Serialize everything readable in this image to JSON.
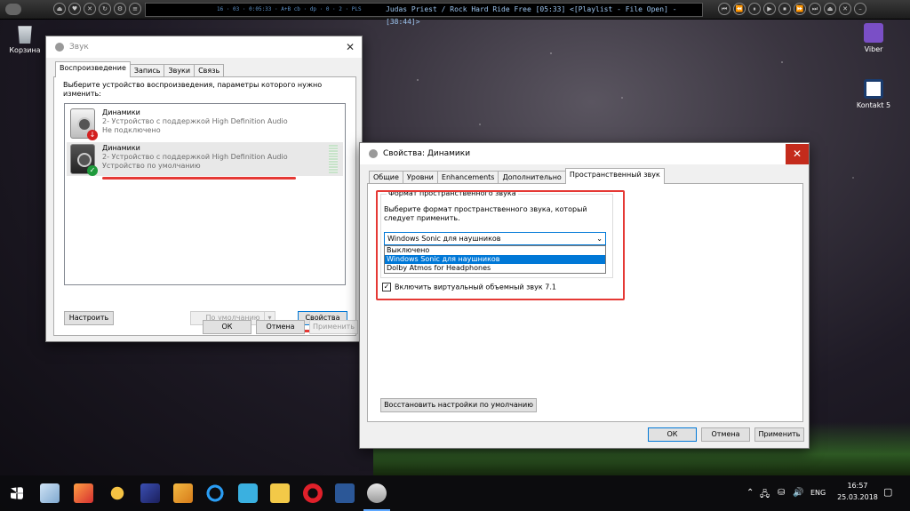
{
  "player": {
    "display_stats": "16 · 03 · 0:05:33 · A+B cb · dp · 0 · 2 · PLS",
    "track": "Judas Priest / Rock Hard Ride Free  [05:33]    <[Playlist - File Open] - [38:44]>"
  },
  "desktop": {
    "icons": [
      {
        "label": "Корзина",
        "icon": "recycle-bin-icon"
      },
      {
        "label": "Viber",
        "icon": "viber-icon"
      },
      {
        "label": "Kontakt 5",
        "icon": "kontakt-icon"
      }
    ]
  },
  "sound": {
    "title": "Звук",
    "tabs": [
      "Воспроизведение",
      "Запись",
      "Звуки",
      "Связь"
    ],
    "instruction": "Выберите устройство воспроизведения, параметры которого нужно изменить:",
    "devices": [
      {
        "name": "Динамики",
        "line2": "2- Устройство с поддержкой High Definition Audio",
        "status": "Не подключено"
      },
      {
        "name": "Динамики",
        "line2": "2- Устройство с поддержкой High Definition Audio",
        "status": "Устройство по умолчанию"
      }
    ],
    "configure_label": "Настроить",
    "default_label": "По умолчанию",
    "properties_label": "Свойства",
    "ok_label": "ОК",
    "cancel_label": "Отмена",
    "apply_label": "Применить"
  },
  "props": {
    "title": "Свойства: Динамики",
    "tabs": [
      "Общие",
      "Уровни",
      "Enhancements",
      "Дополнительно",
      "Пространственный звук"
    ],
    "group_title": "Формат пространственного звука",
    "description": "Выберите формат пространственного звука, который следует применить.",
    "selected": "Windows Sonic для наушников",
    "options": [
      "Выключено",
      "Windows Sonic для наушников",
      "Dolby Atmos for Headphones"
    ],
    "checkbox_label": "Включить виртуальный объемный звук 7.1",
    "restore_label": "Восстановить настройки по умолчанию",
    "ok_label": "ОК",
    "cancel_label": "Отмена",
    "apply_label": "Применить"
  },
  "tray": {
    "language": "ENG",
    "time": "16:57",
    "date": "25.03.2018"
  },
  "colors": {
    "accent": "#0078d7",
    "annotation": "#e53935"
  }
}
